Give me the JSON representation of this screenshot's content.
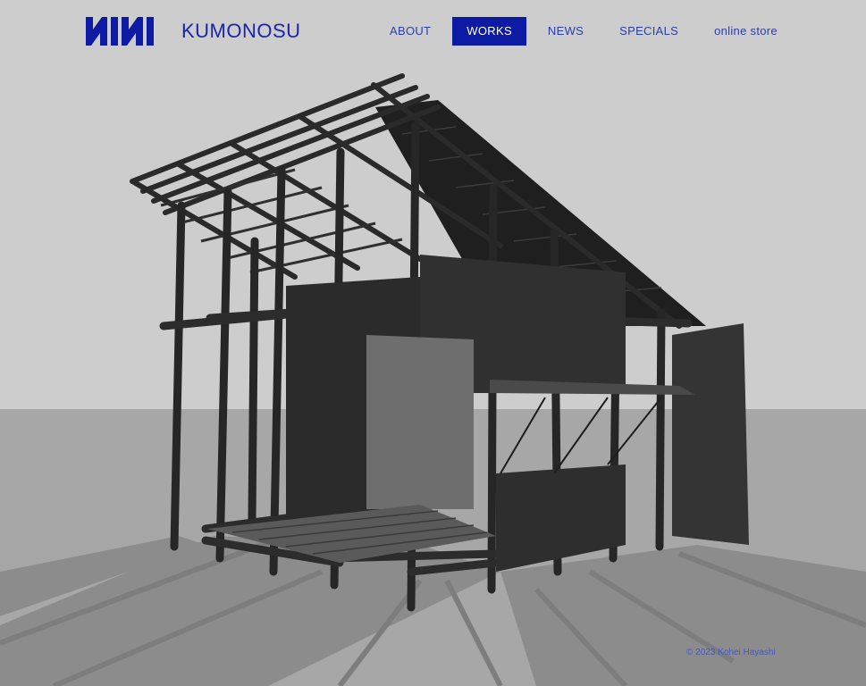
{
  "brand": {
    "logo_text": "NIW",
    "site_name": "KUMONOSU"
  },
  "nav": {
    "items": [
      {
        "label": "ABOUT",
        "active": false
      },
      {
        "label": "WORKS",
        "active": true
      },
      {
        "label": "NEWS",
        "active": false
      },
      {
        "label": "SPECIALS",
        "active": false
      },
      {
        "label": "online store",
        "active": false
      }
    ]
  },
  "footer": {
    "copyright": "© 2023 Kohei Hayashi"
  },
  "colors": {
    "accent": "#0d1aa3",
    "brand_text": "#1826a8",
    "sky": "#cfcfcf",
    "ground": "#a9a9a9",
    "structure": "#2a2a2a"
  },
  "scene": {
    "subject": "3d-render-black-timber-pavilion"
  }
}
